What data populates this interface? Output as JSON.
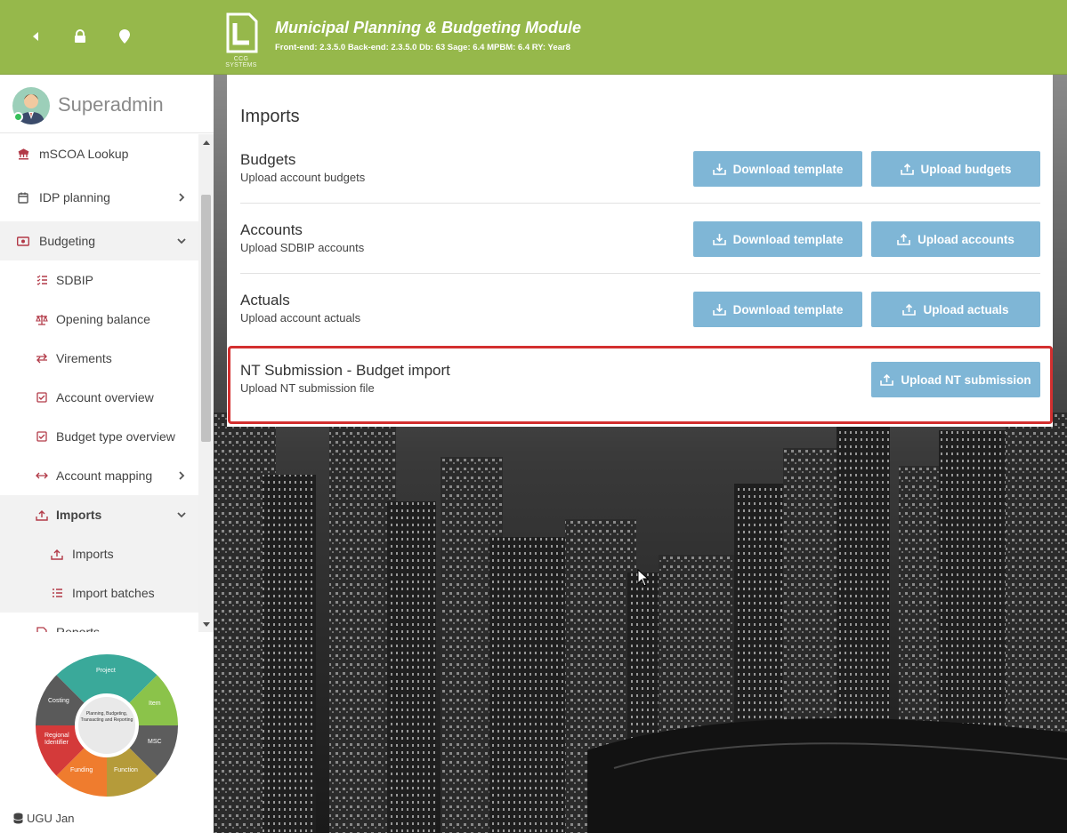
{
  "header": {
    "icons": [
      "back-icon",
      "lock-icon",
      "location-icon"
    ],
    "logo_caption": "CCG SYSTEMS",
    "title": "Municipal Planning & Budgeting Module",
    "versions": "Front-end: 2.3.5.0 Back-end: 2.3.5.0 Db: 63 Sage: 6.4 MPBM: 6.4 RY: Year8",
    "accent": "#96b84b"
  },
  "sidebar": {
    "username": "Superadmin",
    "items": [
      {
        "label": "mSCOA Lookup",
        "icon": "bank-icon"
      },
      {
        "label": "IDP planning",
        "icon": "calendar-icon"
      },
      {
        "label": "Budgeting",
        "icon": "money-icon"
      },
      {
        "label": "SDBIP",
        "icon": "list-check-icon"
      },
      {
        "label": "Opening balance",
        "icon": "scale-icon"
      },
      {
        "label": "Virements",
        "icon": "transfer-icon"
      },
      {
        "label": "Account overview",
        "icon": "checkbox-icon"
      },
      {
        "label": "Budget type overview",
        "icon": "checkbox-icon"
      },
      {
        "label": "Account mapping",
        "icon": "arrows-h-icon"
      },
      {
        "label": "Imports",
        "icon": "upload-icon"
      },
      {
        "label": "Imports",
        "icon": "upload-icon"
      },
      {
        "label": "Import batches",
        "icon": "list-icon"
      },
      {
        "label": "Reports",
        "icon": "report-icon"
      }
    ],
    "wheel": {
      "center": "Planning, Budgeting, Transacting and Reporting",
      "segments": [
        "Project",
        "Item",
        "MSC",
        "Function",
        "Funding",
        "Regional Identifier",
        "Costing"
      ]
    },
    "database": "UGU Jan"
  },
  "main": {
    "title": "Imports",
    "sections": [
      {
        "title": "Budgets",
        "subtitle": "Upload account budgets",
        "download_label": "Download template",
        "upload_label": "Upload budgets"
      },
      {
        "title": "Accounts",
        "subtitle": "Upload SDBIP accounts",
        "download_label": "Download template",
        "upload_label": "Upload accounts"
      },
      {
        "title": "Actuals",
        "subtitle": "Upload account actuals",
        "download_label": "Download template",
        "upload_label": "Upload actuals"
      },
      {
        "title": "NT Submission - Budget import",
        "subtitle": "Upload NT submission file",
        "upload_label": "Upload NT submission"
      }
    ],
    "button_color": "#7fb6d6",
    "highlight_color": "#d32f2f"
  }
}
